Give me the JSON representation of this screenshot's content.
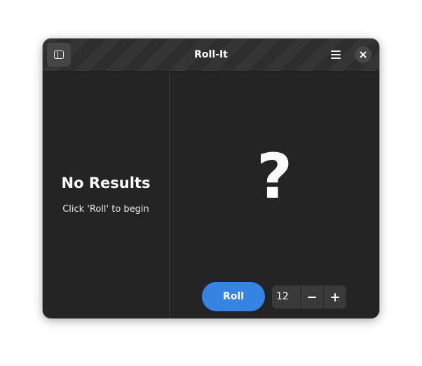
{
  "window": {
    "title": "Roll-It"
  },
  "header": {
    "sidebar_toggle_icon": "sidebar-show-icon",
    "menu_icon": "hamburger-menu-icon",
    "close_icon": "close-icon"
  },
  "sidebar": {
    "empty_title": "No Results",
    "empty_subtitle": "Click 'Roll' to begin"
  },
  "main": {
    "result": "?",
    "roll_label": "Roll",
    "max_value": "12",
    "decrement_icon": "minus-icon",
    "increment_icon": "plus-icon"
  },
  "colors": {
    "accent": "#3584e4",
    "window_bg": "#242424",
    "headerbar_bg": "#2e2e2e"
  }
}
